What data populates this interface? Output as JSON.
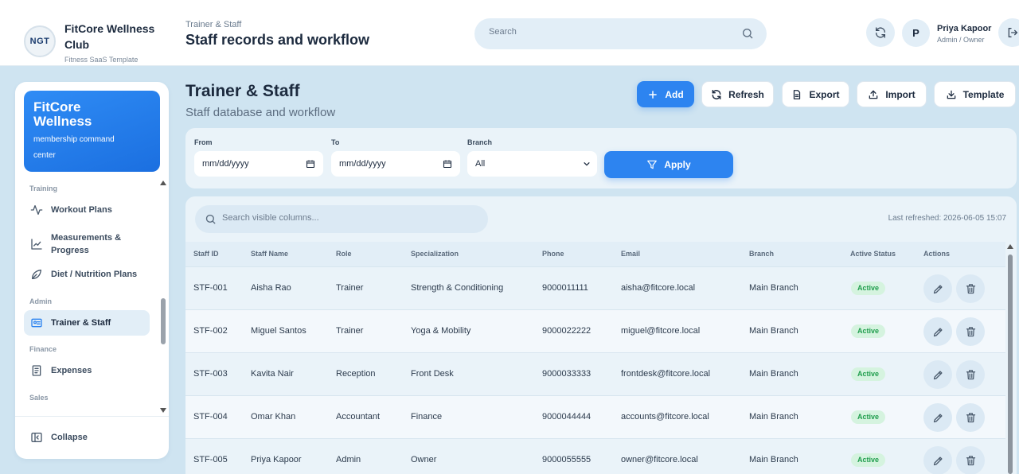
{
  "header": {
    "logo_text": "NGT",
    "brand_name": "FitCore Wellness Club",
    "brand_sub": "Fitness SaaS Template",
    "breadcrumb": "Trainer & Staff",
    "page_title": "Staff records and workflow",
    "search_placeholder": "Search",
    "user_initial": "P",
    "user_name": "Priya Kapoor",
    "user_role": "Admin / Owner"
  },
  "sidebar": {
    "card_title": "FitCore Wellness",
    "card_sub": "membership command center",
    "sections": {
      "training": "Training",
      "admin": "Admin",
      "finance": "Finance",
      "sales": "Sales"
    },
    "items": {
      "workout": "Workout Plans",
      "measurements": "Measurements & Progress",
      "diet": "Diet / Nutrition Plans",
      "trainer": "Trainer & Staff",
      "expenses": "Expenses",
      "collapse": "Collapse"
    }
  },
  "main": {
    "title": "Trainer & Staff",
    "subtitle": "Staff database and workflow",
    "toolbar": {
      "add": "Add",
      "refresh": "Refresh",
      "export": "Export",
      "import": "Import",
      "template": "Template"
    }
  },
  "filter": {
    "from_label": "From",
    "from_value": "mm/dd/yyyy",
    "to_label": "To",
    "to_value": "mm/dd/yyyy",
    "branch_label": "Branch",
    "branch_value": "All",
    "apply": "Apply"
  },
  "table": {
    "search_placeholder": "Search visible columns...",
    "last_refreshed": "Last refreshed: 2026-06-05 15:07",
    "headers": [
      "Staff ID",
      "Staff Name",
      "Role",
      "Specialization",
      "Phone",
      "Email",
      "Branch",
      "Active Status",
      "Actions"
    ],
    "rows": [
      {
        "id": "STF-001",
        "name": "Aisha Rao",
        "role": "Trainer",
        "spec": "Strength & Conditioning",
        "phone": "9000011111",
        "email": "aisha@fitcore.local",
        "branch": "Main Branch",
        "status": "Active"
      },
      {
        "id": "STF-002",
        "name": "Miguel Santos",
        "role": "Trainer",
        "spec": "Yoga & Mobility",
        "phone": "9000022222",
        "email": "miguel@fitcore.local",
        "branch": "Main Branch",
        "status": "Active"
      },
      {
        "id": "STF-003",
        "name": "Kavita Nair",
        "role": "Reception",
        "spec": "Front Desk",
        "phone": "9000033333",
        "email": "frontdesk@fitcore.local",
        "branch": "Main Branch",
        "status": "Active"
      },
      {
        "id": "STF-004",
        "name": "Omar Khan",
        "role": "Accountant",
        "spec": "Finance",
        "phone": "9000044444",
        "email": "accounts@fitcore.local",
        "branch": "Main Branch",
        "status": "Active"
      },
      {
        "id": "STF-005",
        "name": "Priya Kapoor",
        "role": "Admin",
        "spec": "Owner",
        "phone": "9000055555",
        "email": "owner@fitcore.local",
        "branch": "Main Branch",
        "status": "Active"
      }
    ]
  },
  "icons": {
    "search": "search-icon",
    "refresh": "refresh-icon",
    "logout": "logout-icon",
    "edit": "pencil-icon",
    "delete": "trash-icon"
  },
  "colors": {
    "accent": "#2d84f0",
    "active_badge_bg": "#d5f3df",
    "active_badge_text": "#1f9d4c"
  }
}
